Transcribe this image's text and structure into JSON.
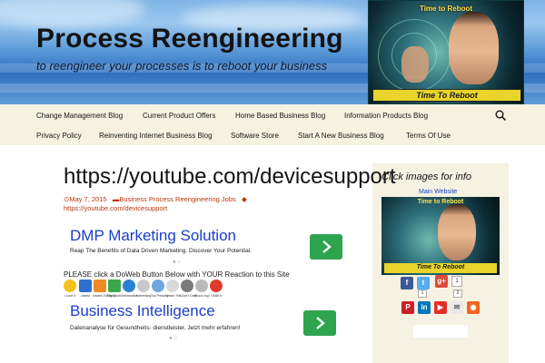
{
  "site": {
    "title": "Process Reengineering",
    "description": "to reengineer your processes is to reboot your business",
    "banner": {
      "top_text": "Time to Reboot",
      "bottom_text": "Time To Reboot"
    }
  },
  "nav": {
    "row1": [
      "Change Management Blog",
      "Current Product Offers",
      "Home Based Business Blog",
      "Information Products Blog"
    ],
    "row2": [
      "Privacy Policy",
      "Reinventing Internet Business Blog",
      "Software Store",
      "Start A New Business Blog",
      "Terms Of Use"
    ],
    "search_icon": "search-icon"
  },
  "post": {
    "title": "https://youtube.com/devicesupport",
    "date": "May 7, 2015",
    "category": "Business Process Reengineering Jobs",
    "tag_link": "https://youtube.com/devicesupport"
  },
  "ads": [
    {
      "title": "DMP Marketing Solution",
      "text": "Reap The Benefits of Data Driven Marketing. Discover Your Potential.",
      "button": "arrow-right-icon"
    },
    {
      "title": "Business Intelligence",
      "text": "Datenanalyse für Gesundheits- dienstleister. Jetzt mehr erfahren!",
      "button": "arrow-right-icon"
    }
  ],
  "doweb": {
    "prompt": "PLEASE click a DoWeb Button Below with YOUR Reaction to this Site",
    "buttons": [
      "I Love It",
      "Useful",
      "Instant-Tidingsly",
      "The Truth!",
      "Informative",
      "Interesting",
      "Too Preachy",
      "I Have This",
      "I Don't Care",
      "Shock Ing!",
      "I Hate It"
    ]
  },
  "sidebar": {
    "heading": "Click images for info",
    "link": "Main Website",
    "image": {
      "top_text": "Time to Reboot",
      "bottom_text": "Time To Reboot"
    },
    "share_counts": [
      "1",
      "2"
    ],
    "social_icons": [
      "facebook-icon",
      "twitter-icon",
      "googleplus-icon",
      "pinterest-icon",
      "linkedin-icon",
      "youtube-icon",
      "email-icon",
      "rss-icon"
    ]
  },
  "colors": {
    "nav_bg": "#f6f2df",
    "sidebar_bg": "#f5f2e2",
    "meta_link": "#bc360a",
    "ad_title": "#1a3ec9",
    "ad_button": "#2ea44f"
  }
}
